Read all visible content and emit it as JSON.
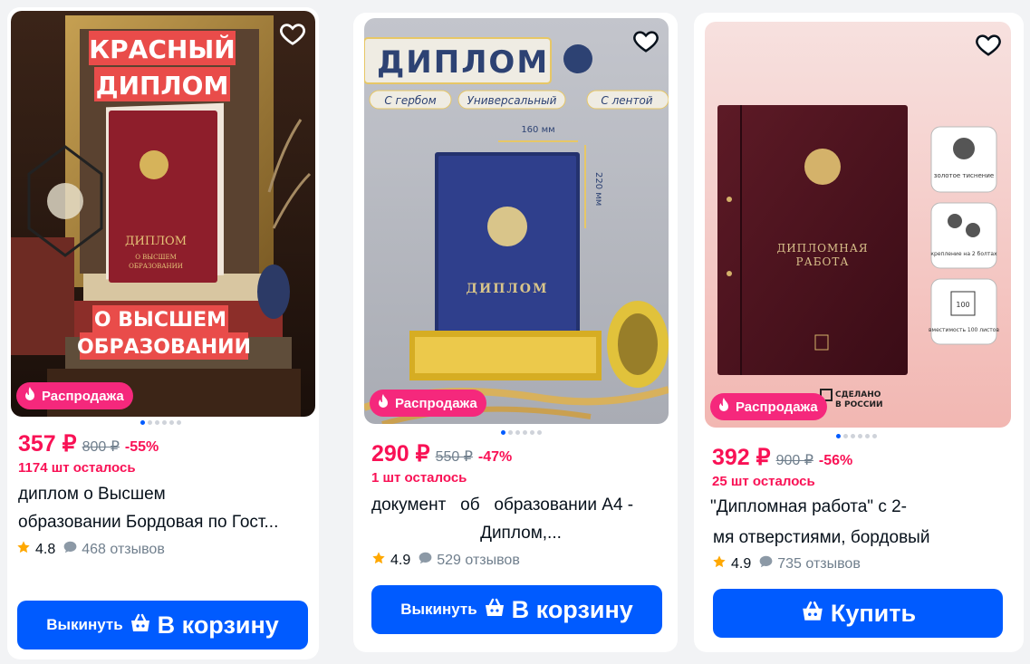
{
  "colors": {
    "accent": "#005bff",
    "price": "#f91155",
    "sale_badge": "#f5287c"
  },
  "products": [
    {
      "image_text": [
        "КРАСНЫЙ",
        "ДИПЛОМ",
        "О ВЫСШЕМ",
        "ОБРАЗОВАНИИ"
      ],
      "book_text": [
        "ДИПЛОМ",
        "О ВЫСШЕМ",
        "ОБРАЗОВАНИИ"
      ],
      "badge": "Распродажа",
      "price": "357 ₽",
      "old_price": "800 ₽",
      "discount": "-55%",
      "stock": "1174 шт осталось",
      "title_line1": "диплом о Высшем",
      "title_line2": "образовании Бордовая по Гост...",
      "rating": "4.8",
      "reviews": "468 отзывов",
      "btn_small": "Выкинуть",
      "btn_big": "В корзину"
    },
    {
      "image_header": "ДИПЛОМ",
      "chips": [
        "С гербом",
        "Универсальный",
        "С лентой"
      ],
      "dim_w": "160 мм",
      "dim_h": "220 мм",
      "book_text": "ДИПЛОМ",
      "badge": "Распродажа",
      "price": "290 ₽",
      "old_price": "550 ₽",
      "discount": "-47%",
      "stock": "1 шт осталось",
      "title_line1": "документ   об   образовании А4 -",
      "title_line2": "Диплом,...",
      "rating": "4.9",
      "reviews": "529 отзывов",
      "btn_small": "Выкинуть",
      "btn_big": "В корзину"
    },
    {
      "book_text": [
        "ДИПЛОМНАЯ",
        "РАБОТА"
      ],
      "features": [
        "золотое тиснение",
        "крепление на 2 болтах",
        "вместимость 100 листов"
      ],
      "capacity_num": "100",
      "made_in": [
        "СДЕЛАНО",
        "В РОССИИ"
      ],
      "badge": "Распродажа",
      "price": "392 ₽",
      "old_price": "900 ₽",
      "discount": "-56%",
      "stock": "25 шт осталось",
      "title_line1": "\"Дипломная работа\" с 2-",
      "title_line2": "мя отверстиями, бордовый",
      "rating": "4.9",
      "reviews": "735 отзывов",
      "btn_big": "Купить"
    }
  ]
}
